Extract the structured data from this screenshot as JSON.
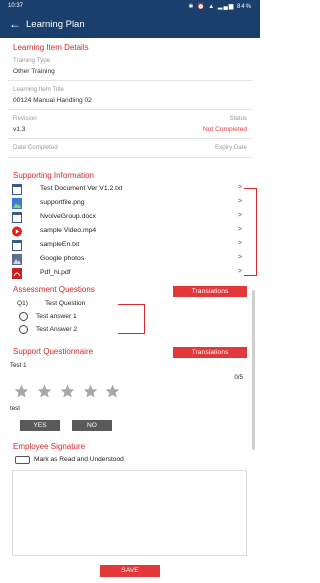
{
  "status_bar": {
    "time": "10:37",
    "icons": "✱ ⏰ ▲ ▂▄▆ 84%"
  },
  "app_bar": {
    "title": "Learning Plan"
  },
  "learning_item_details": {
    "heading": "Learning Item Details",
    "training_type_label": "Training Type",
    "training_type_value": "Other Training",
    "title_label": "Learning Item Title",
    "title_value": "00124 Manual Handling 02",
    "revision_label": "Revision",
    "revision_value": "v1.3",
    "status_label": "Status",
    "status_value": "Not Completed",
    "date_completed_label": "Date Completed",
    "expiry_date_label": "Expiry Date"
  },
  "supporting_information": {
    "heading": "Supporting Information",
    "files": [
      {
        "name": "Test Document  Ver V1.2.txt",
        "icon": "document-icon"
      },
      {
        "name": "supportfile.png",
        "icon": "image-icon"
      },
      {
        "name": "NvolveGroup.docx",
        "icon": "document-icon"
      },
      {
        "name": "sample Video.mp4",
        "icon": "video-play-icon"
      },
      {
        "name": "sampleEn.txt",
        "icon": "document-icon"
      },
      {
        "name": "Google photos",
        "icon": "image-icon"
      },
      {
        "name": "Pdf_hi.pdf",
        "icon": "pdf-icon"
      }
    ]
  },
  "assessment_questions": {
    "heading": "Assessment Questions",
    "translations_label": "Translations",
    "question_number": "Q1)",
    "question_text": "Test Question",
    "answers": [
      "Test answer 1",
      "Test Answer 2"
    ]
  },
  "support_questionnaire": {
    "heading": "Support Questionnaire",
    "translations_label": "Translations",
    "item1_label": "Test 1",
    "rating_value": 0,
    "rating_max": 5,
    "rating_text": "0/5",
    "item2_label": "test",
    "yes_label": "YES",
    "no_label": "NO"
  },
  "employee_signature": {
    "heading": "Employee Signature",
    "checkbox_label": "Mark as Read and Understood"
  },
  "footer": {
    "save_label": "SAVE"
  },
  "colors": {
    "brand": "#1b3f6d",
    "accent": "#e2383a",
    "status_not_completed": "#e0403f"
  }
}
